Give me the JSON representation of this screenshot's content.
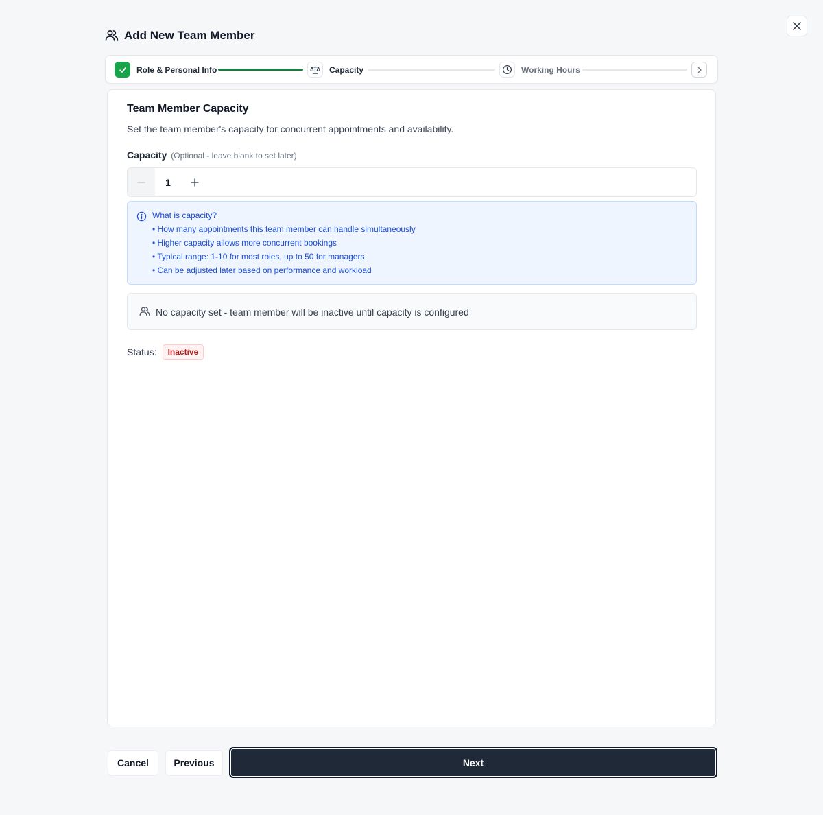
{
  "header": {
    "title": "Add New Team Member",
    "icon": "users-icon"
  },
  "stepper": {
    "steps": [
      {
        "label": "Role & Personal Info",
        "state": "completed",
        "icon": "check-icon"
      },
      {
        "label": "Capacity",
        "state": "current",
        "icon": "scale-icon"
      },
      {
        "label": "Working Hours",
        "state": "upcoming",
        "icon": "clock-icon"
      }
    ],
    "next_icon": "chevron-right-icon"
  },
  "card": {
    "title": "Team Member Capacity",
    "description": "Set the team member's capacity for concurrent appointments and availability.",
    "capacity_label": "Capacity",
    "capacity_hint": "(Optional - leave blank to set later)",
    "capacity_value": "1",
    "decrement_symbol": "−",
    "increment_symbol": "+",
    "info": {
      "title": "What is capacity?",
      "items": [
        "• How many appointments this team member can handle simultaneously",
        "• Higher capacity allows more concurrent bookings",
        "• Typical range: 1-10 for most roles, up to 50 for managers",
        "• Can be adjusted later based on performance and workload"
      ]
    },
    "notice": "No capacity set - team member will be inactive until capacity is configured",
    "status_label": "Status:",
    "status_value": "Inactive"
  },
  "footer": {
    "cancel_label": "Cancel",
    "previous_label": "Previous",
    "next_label": "Next"
  },
  "colors": {
    "primary_dark": "#1f2937",
    "success": "#16a34a",
    "info_text": "#1d4ed8",
    "info_bg": "#eef5ff",
    "danger": "#b91c1c"
  }
}
